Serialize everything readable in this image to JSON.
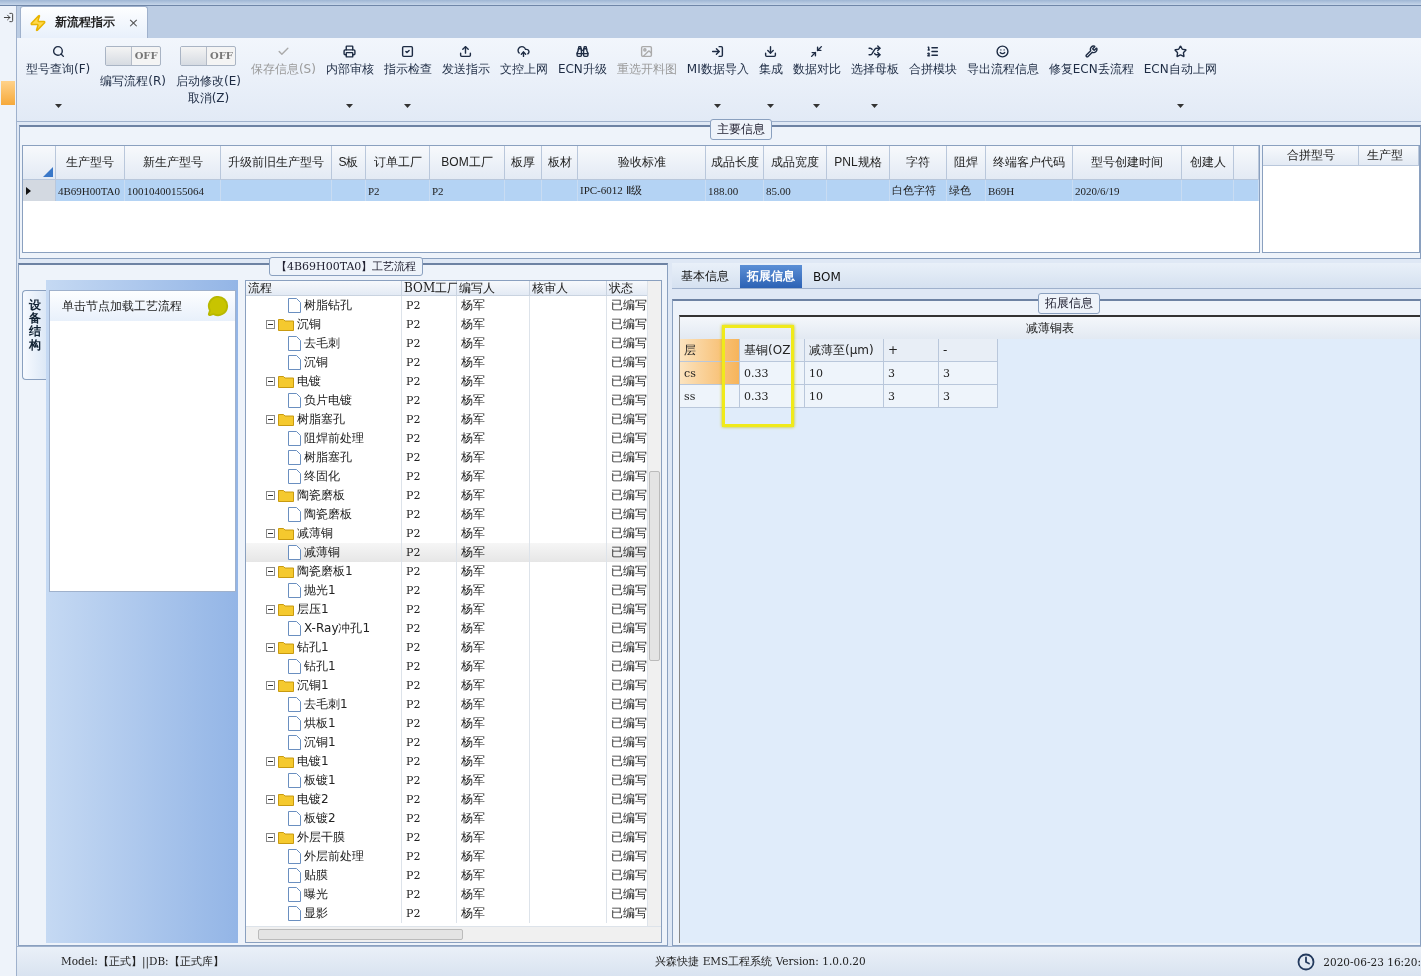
{
  "document_tab": {
    "title": "新流程指示",
    "close": "×",
    "selected": true
  },
  "toolbar": [
    {
      "kind": "button",
      "lines": [
        "型号查询(F)"
      ],
      "disabled": false,
      "dropdown": true
    },
    {
      "kind": "toggle",
      "lines": [
        "编写流程(R)"
      ],
      "switch_text": "OFF",
      "on": false
    },
    {
      "kind": "toggle",
      "lines": [
        "启动修改(E)",
        "取消(Z)"
      ],
      "switch_text": "OFF",
      "on": false
    },
    {
      "kind": "button",
      "lines": [
        "保存信息(S)"
      ],
      "disabled": true,
      "dropdown": false
    },
    {
      "kind": "button",
      "lines": [
        "内部审核"
      ],
      "disabled": false,
      "dropdown": true
    },
    {
      "kind": "button",
      "lines": [
        "指示检查"
      ],
      "disabled": false,
      "dropdown": true
    },
    {
      "kind": "button",
      "lines": [
        "发送指示"
      ],
      "disabled": false,
      "dropdown": false
    },
    {
      "kind": "button",
      "lines": [
        "文控上网"
      ],
      "disabled": false,
      "dropdown": false
    },
    {
      "kind": "button",
      "lines": [
        "ECN升级"
      ],
      "disabled": false,
      "dropdown": false
    },
    {
      "kind": "button",
      "lines": [
        "重选开料图"
      ],
      "disabled": true,
      "dropdown": false
    },
    {
      "kind": "button",
      "lines": [
        "MI数据导入"
      ],
      "disabled": false,
      "dropdown": true
    },
    {
      "kind": "button",
      "lines": [
        "集成"
      ],
      "disabled": false,
      "dropdown": true
    },
    {
      "kind": "button",
      "lines": [
        "数据对比"
      ],
      "disabled": false,
      "dropdown": true
    },
    {
      "kind": "button",
      "lines": [
        "选择母板"
      ],
      "disabled": false,
      "dropdown": true
    },
    {
      "kind": "button",
      "lines": [
        "合拼模块"
      ],
      "disabled": false,
      "dropdown": false
    },
    {
      "kind": "button",
      "lines": [
        "导出流程信息"
      ],
      "disabled": false,
      "dropdown": false
    },
    {
      "kind": "button",
      "lines": [
        "修复ECN丢流程"
      ],
      "disabled": false,
      "dropdown": false
    },
    {
      "kind": "button",
      "lines": [
        "ECN自动上网"
      ],
      "disabled": false,
      "dropdown": true
    }
  ],
  "main_info": {
    "legend": "主要信息",
    "columns": [
      "生产型号",
      "新生产型号",
      "升级前旧生产型号",
      "S板",
      "订单工厂",
      "BOM工厂",
      "板厚",
      "板材",
      "验收标准",
      "成品长度",
      "成品宽度",
      "PNL规格",
      "字符",
      "阻焊",
      "终端客户代码",
      "型号创建时间",
      "创建人"
    ],
    "rows": [
      {
        "selected": true,
        "cells": [
          "4B69H00TA0",
          "10010400155064",
          null,
          null,
          "P2",
          "P2",
          null,
          null,
          "IPC-6012 Ⅱ级",
          "188.00",
          "85.00",
          null,
          "白色字符",
          "绿色",
          "B69H",
          "2020/6/19",
          null
        ]
      }
    ],
    "side_columns": [
      "合拼型号",
      "生产型"
    ]
  },
  "process": {
    "legend": "【4B69H00TA0】工艺流程",
    "side_tab": "设备结构",
    "hint": "单击节点加载工艺流程",
    "columns": [
      "流程",
      "BOM工厂",
      "编写人",
      "核审人",
      "状态"
    ],
    "tree": [
      {
        "kind": "leaf",
        "name": "树脂钻孔",
        "bom": "P2",
        "author": "杨军",
        "status": "已编写",
        "selected": false
      },
      {
        "kind": "folder",
        "name": "沉铜",
        "bom": "P2",
        "author": "杨军",
        "status": "已编写",
        "selected": false,
        "expanded": true,
        "children": [
          {
            "kind": "leaf",
            "name": "去毛刺",
            "bom": "P2",
            "author": "杨军",
            "status": "已编写",
            "selected": false
          },
          {
            "kind": "leaf",
            "name": "沉铜",
            "bom": "P2",
            "author": "杨军",
            "status": "已编写",
            "selected": false
          }
        ]
      },
      {
        "kind": "folder",
        "name": "电镀",
        "bom": "P2",
        "author": "杨军",
        "status": "已编写",
        "selected": false,
        "expanded": true,
        "children": [
          {
            "kind": "leaf",
            "name": "负片电镀",
            "bom": "P2",
            "author": "杨军",
            "status": "已编写",
            "selected": false
          }
        ]
      },
      {
        "kind": "folder",
        "name": "树脂塞孔",
        "bom": "P2",
        "author": "杨军",
        "status": "已编写",
        "selected": false,
        "expanded": true,
        "children": [
          {
            "kind": "leaf",
            "name": "阻焊前处理",
            "bom": "P2",
            "author": "杨军",
            "status": "已编写",
            "selected": false
          },
          {
            "kind": "leaf",
            "name": "树脂塞孔",
            "bom": "P2",
            "author": "杨军",
            "status": "已编写",
            "selected": false
          },
          {
            "kind": "leaf",
            "name": "终固化",
            "bom": "P2",
            "author": "杨军",
            "status": "已编写",
            "selected": false
          }
        ]
      },
      {
        "kind": "folder",
        "name": "陶瓷磨板",
        "bom": "P2",
        "author": "杨军",
        "status": "已编写",
        "selected": false,
        "expanded": true,
        "children": [
          {
            "kind": "leaf",
            "name": "陶瓷磨板",
            "bom": "P2",
            "author": "杨军",
            "status": "已编写",
            "selected": false
          }
        ]
      },
      {
        "kind": "folder",
        "name": "减薄铜",
        "bom": "P2",
        "author": "杨军",
        "status": "已编写",
        "selected": false,
        "expanded": true,
        "children": [
          {
            "kind": "leaf",
            "name": "减薄铜",
            "bom": "P2",
            "author": "杨军",
            "status": "已编写",
            "selected": true
          }
        ]
      },
      {
        "kind": "folder",
        "name": "陶瓷磨板1",
        "bom": "P2",
        "author": "杨军",
        "status": "已编写",
        "selected": false,
        "expanded": true,
        "children": [
          {
            "kind": "leaf",
            "name": "抛光1",
            "bom": "P2",
            "author": "杨军",
            "status": "已编写",
            "selected": false
          }
        ]
      },
      {
        "kind": "folder",
        "name": "层压1",
        "bom": "P2",
        "author": "杨军",
        "status": "已编写",
        "selected": false,
        "expanded": true,
        "children": [
          {
            "kind": "leaf",
            "name": "X-Ray冲孔1",
            "bom": "P2",
            "author": "杨军",
            "status": "已编写",
            "selected": false
          }
        ]
      },
      {
        "kind": "folder",
        "name": "钻孔1",
        "bom": "P2",
        "author": "杨军",
        "status": "已编写",
        "selected": false,
        "expanded": true,
        "children": [
          {
            "kind": "leaf",
            "name": "钻孔1",
            "bom": "P2",
            "author": "杨军",
            "status": "已编写",
            "selected": false
          }
        ]
      },
      {
        "kind": "folder",
        "name": "沉铜1",
        "bom": "P2",
        "author": "杨军",
        "status": "已编写",
        "selected": false,
        "expanded": true,
        "children": [
          {
            "kind": "leaf",
            "name": "去毛刺1",
            "bom": "P2",
            "author": "杨军",
            "status": "已编写",
            "selected": false
          },
          {
            "kind": "leaf",
            "name": "烘板1",
            "bom": "P2",
            "author": "杨军",
            "status": "已编写",
            "selected": false
          },
          {
            "kind": "leaf",
            "name": "沉铜1",
            "bom": "P2",
            "author": "杨军",
            "status": "已编写",
            "selected": false
          }
        ]
      },
      {
        "kind": "folder",
        "name": "电镀1",
        "bom": "P2",
        "author": "杨军",
        "status": "已编写",
        "selected": false,
        "expanded": true,
        "children": [
          {
            "kind": "leaf",
            "name": "板镀1",
            "bom": "P2",
            "author": "杨军",
            "status": "已编写",
            "selected": false
          }
        ]
      },
      {
        "kind": "folder",
        "name": "电镀2",
        "bom": "P2",
        "author": "杨军",
        "status": "已编写",
        "selected": false,
        "expanded": true,
        "children": [
          {
            "kind": "leaf",
            "name": "板镀2",
            "bom": "P2",
            "author": "杨军",
            "status": "已编写",
            "selected": false
          }
        ]
      },
      {
        "kind": "folder",
        "name": "外层干膜",
        "bom": "P2",
        "author": "杨军",
        "status": "已编写",
        "selected": false,
        "expanded": true,
        "children": [
          {
            "kind": "leaf",
            "name": "外层前处理",
            "bom": "P2",
            "author": "杨军",
            "status": "已编写",
            "selected": false
          },
          {
            "kind": "leaf",
            "name": "贴膜",
            "bom": "P2",
            "author": "杨军",
            "status": "已编写",
            "selected": false
          },
          {
            "kind": "leaf",
            "name": "曝光",
            "bom": "P2",
            "author": "杨军",
            "status": "已编写",
            "selected": false
          },
          {
            "kind": "leaf",
            "name": "显影",
            "bom": "P2",
            "author": "杨军",
            "status": "已编写",
            "selected": false
          }
        ]
      }
    ]
  },
  "detail": {
    "tabs": [
      {
        "label": "基本信息",
        "selected": false
      },
      {
        "label": "拓展信息",
        "selected": true
      },
      {
        "label": "BOM",
        "selected": false
      }
    ],
    "legend": "拓展信息",
    "table_title": "减薄铜表",
    "columns": [
      {
        "label": "层",
        "highlighted": false
      },
      {
        "label": "基铜(OZ",
        "highlighted": true
      },
      {
        "label": "减薄至(μm)",
        "highlighted": false
      },
      {
        "label": "+",
        "highlighted": false
      },
      {
        "label": "-",
        "highlighted": false
      }
    ],
    "rows": [
      {
        "selected": true,
        "cells": [
          "cs",
          "0.33",
          "10",
          "3",
          "3"
        ]
      },
      {
        "selected": false,
        "cells": [
          "ss",
          "0.33",
          "10",
          "3",
          "3"
        ]
      }
    ]
  },
  "status_bar": {
    "model": "Model:【正式】||DB:【正式库】",
    "app": "兴森快捷 EMS工程系统 Version: 1.0.0.20",
    "datetime": "2020-06-23 16:20:"
  }
}
